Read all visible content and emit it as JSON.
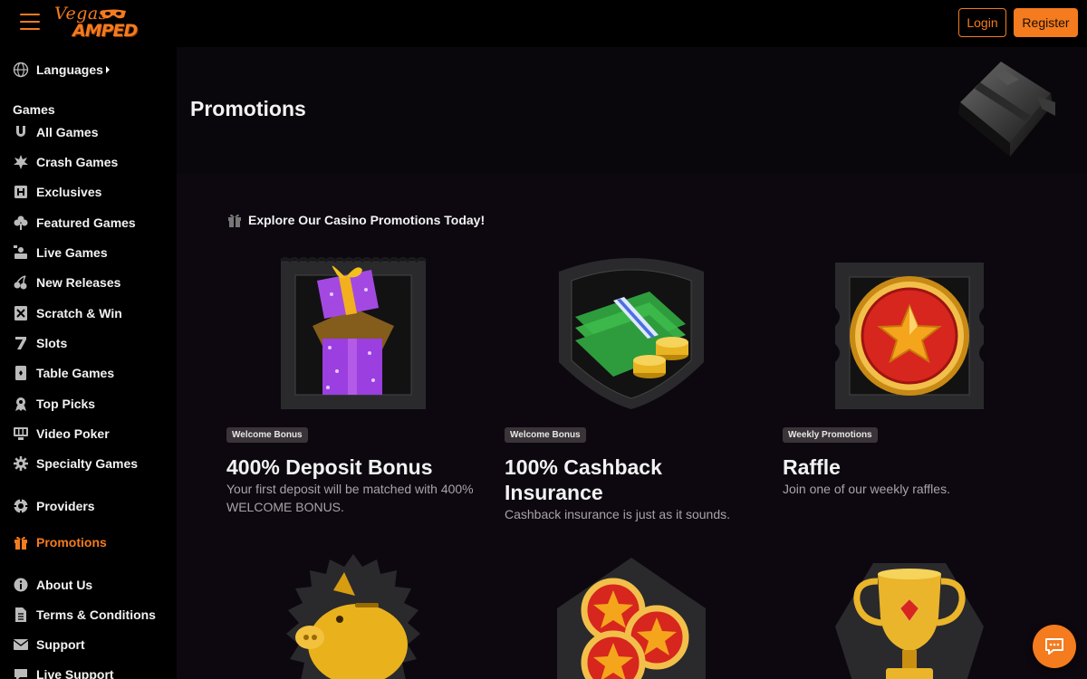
{
  "header": {
    "logo_line1": "Vegas",
    "logo_line2": "AMPED",
    "login_label": "Login",
    "register_label": "Register"
  },
  "sidebar": {
    "languages": "Languages",
    "games_heading": "Games",
    "games": [
      {
        "label": "All Games",
        "icon": "horseshoe-icon"
      },
      {
        "label": "Crash Games",
        "icon": "explosion-icon"
      },
      {
        "label": "Exclusives",
        "icon": "exclusive-icon"
      },
      {
        "label": "Featured Games",
        "icon": "clover-icon"
      },
      {
        "label": "Live Games",
        "icon": "live-dealer-icon"
      },
      {
        "label": "New Releases",
        "icon": "cherries-icon"
      },
      {
        "label": "Scratch & Win",
        "icon": "scratch-card-icon"
      },
      {
        "label": "Slots",
        "icon": "seven-icon"
      },
      {
        "label": "Table Games",
        "icon": "cards-icon"
      },
      {
        "label": "Top Picks",
        "icon": "medal-icon"
      },
      {
        "label": "Video Poker",
        "icon": "video-poker-icon"
      },
      {
        "label": "Specialty Games",
        "icon": "gear-icon"
      }
    ],
    "providers": "Providers",
    "promotions": "Promotions",
    "about": "About Us",
    "terms": "Terms & Conditions",
    "support": "Support",
    "live_support": "Live Support"
  },
  "main": {
    "title": "Promotions",
    "section_heading": "Explore Our Casino Promotions Today!",
    "cards": [
      {
        "badge": "Welcome Bonus",
        "title": "400% Deposit Bonus",
        "desc": "Your first deposit will be matched with 400% WELCOME BONUS."
      },
      {
        "badge": "Welcome Bonus",
        "title": "100% Cashback Insurance",
        "desc": "Cashback insurance is just as it sounds."
      },
      {
        "badge": "Weekly Promotions",
        "title": "Raffle",
        "desc": "Join one of our weekly raffles."
      }
    ]
  },
  "colors": {
    "accent": "#f47b1e",
    "background": "#000000",
    "panel": "#0d080f"
  }
}
